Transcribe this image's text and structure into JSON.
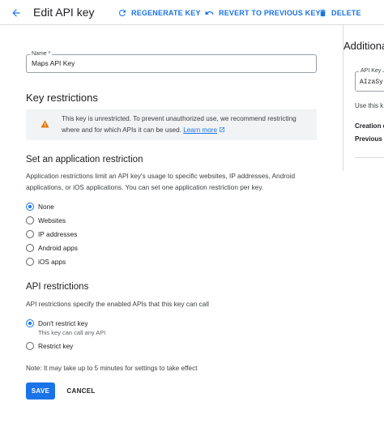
{
  "header": {
    "title": "Edit API key",
    "regenerate_label": "REGENERATE KEY",
    "revert_label": "REVERT TO PREVIOUS KEY",
    "delete_label": "DELETE"
  },
  "name_field": {
    "label": "Name *",
    "value": "Maps API Key"
  },
  "key_restrictions": {
    "heading": "Key restrictions",
    "warning_text": "This key is unrestricted. To prevent unauthorized use, we recommend restricting where and for which APIs it can be used.",
    "learn_more": "Learn more"
  },
  "application_restriction": {
    "heading": "Set an application restriction",
    "description": "Application restrictions limit an API key's usage to specific websites, IP addresses, Android applications, or iOS applications. You can set one application restriction per key.",
    "options": [
      "None",
      "Websites",
      "IP addresses",
      "Android apps",
      "iOS apps"
    ],
    "selected": "None"
  },
  "api_restrictions": {
    "heading": "API restrictions",
    "description": "API restrictions specify the enabled APIs that this key can call",
    "options": [
      "Don't restrict key",
      "Restrict key"
    ],
    "dont_restrict_sub": "This key can call any API",
    "selected": "Don't restrict key"
  },
  "note": "Note: It may take up to 5 minutes for settings to take effect",
  "actions": {
    "save_label": "SAVE",
    "cancel_label": "CANCEL"
  },
  "side_panel": {
    "title": "Additiona",
    "api_key_label": "API Key",
    "api_key_value": "AIzaSy",
    "use_text": "Use this k",
    "creation_label": "Creation d",
    "previous_label": "Previous"
  },
  "colors": {
    "accent": "#1a73e8",
    "warning": "#e37400",
    "divider": "#dadce0"
  }
}
